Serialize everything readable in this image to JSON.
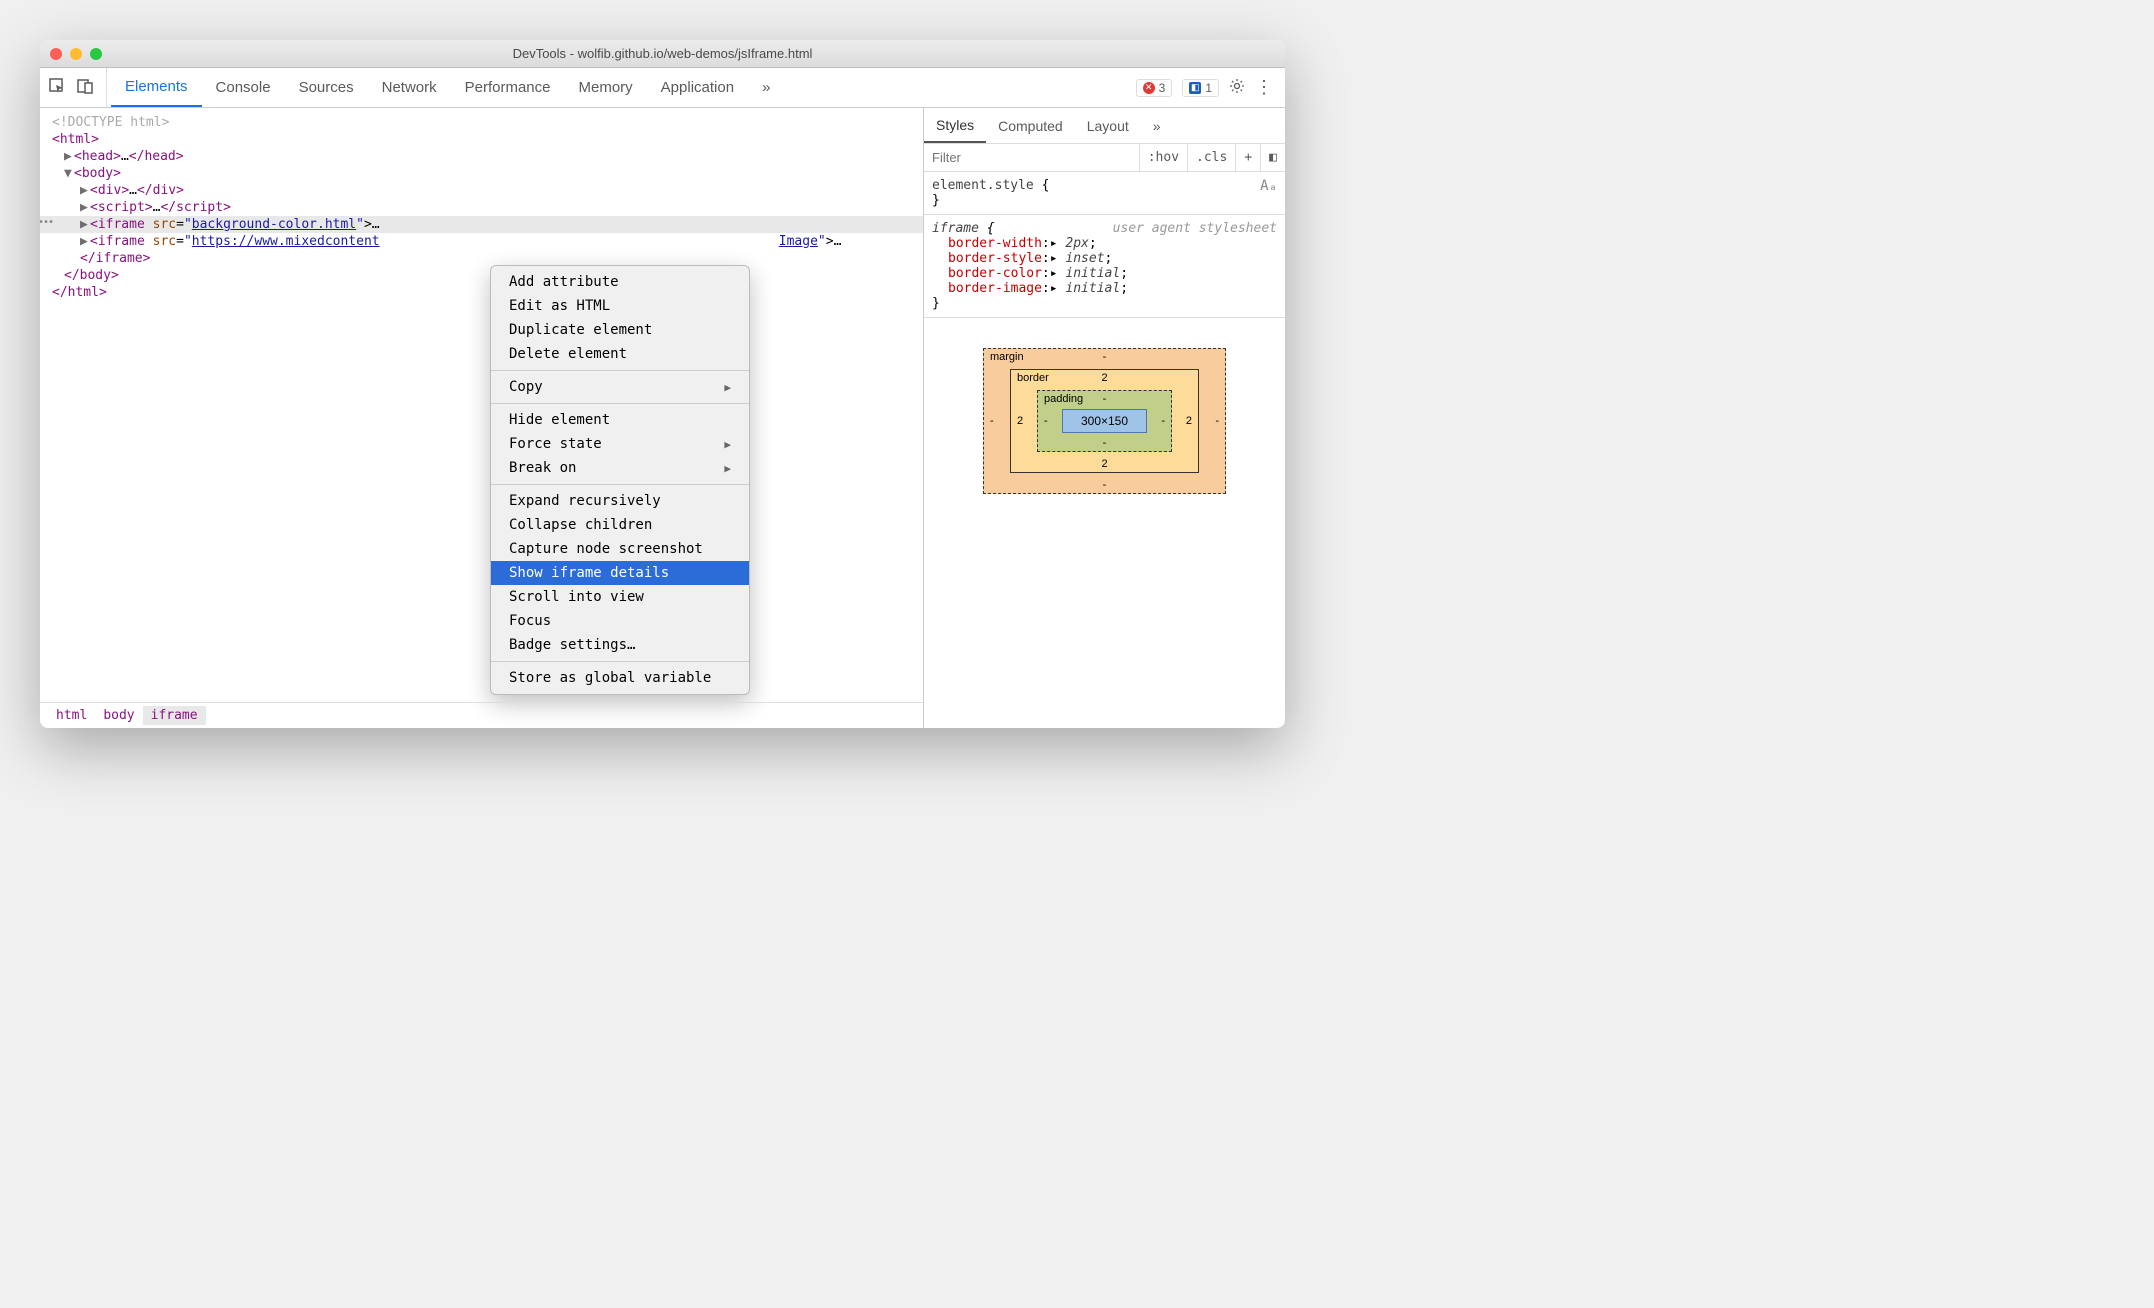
{
  "window": {
    "title": "DevTools - wolfib.github.io/web-demos/jsIframe.html"
  },
  "tabs": [
    "Elements",
    "Console",
    "Sources",
    "Network",
    "Performance",
    "Memory",
    "Application"
  ],
  "active_tab": "Elements",
  "more_tabs_glyph": "»",
  "errors": {
    "error_count": "3",
    "issue_count": "1"
  },
  "dom": {
    "doctype": "<!DOCTYPE html>",
    "html_open": "html",
    "head": {
      "open": "head",
      "ell": "…",
      "close": "head"
    },
    "body_open": "body",
    "div": {
      "open": "div",
      "ell": "…",
      "close": "div"
    },
    "script": {
      "open": "script",
      "ell": "…",
      "close": "script"
    },
    "iframe1": {
      "tag": "iframe",
      "attr": "src",
      "val": "background-color.html",
      "ell": ">…"
    },
    "iframe2": {
      "tag": "iframe",
      "attr": "src",
      "val": "https://www.mixedcontent",
      "title_attr": "Image",
      "ell": ">…"
    },
    "iframe_close": "iframe",
    "body_close": "body",
    "html_close": "html"
  },
  "breadcrumb": [
    "html",
    "body",
    "iframe"
  ],
  "context_menu": {
    "group1": [
      "Add attribute",
      "Edit as HTML",
      "Duplicate element",
      "Delete element"
    ],
    "copy": "Copy",
    "group2": [
      "Hide element"
    ],
    "force_state": "Force state",
    "break_on": "Break on",
    "group3": [
      "Expand recursively",
      "Collapse children",
      "Capture node screenshot"
    ],
    "highlighted": "Show iframe details",
    "group4": [
      "Scroll into view",
      "Focus",
      "Badge settings…"
    ],
    "group5": [
      "Store as global variable"
    ]
  },
  "styles_panel": {
    "subtabs": [
      "Styles",
      "Computed",
      "Layout"
    ],
    "active_subtab": "Styles",
    "filter_placeholder": "Filter",
    "hov": ":hov",
    "cls": ".cls",
    "element_style": {
      "selector": "element.style",
      "open": " {",
      "close": "}"
    },
    "iframe_rule": {
      "selector": "iframe",
      "open": " {",
      "source": "user agent stylesheet",
      "props": [
        {
          "name": "border-width",
          "value": "2px",
          "arrow": "▸"
        },
        {
          "name": "border-style",
          "value": "inset",
          "arrow": "▸"
        },
        {
          "name": "border-color",
          "value": "initial",
          "arrow": "▸"
        },
        {
          "name": "border-image",
          "value": "initial",
          "arrow": "▸"
        }
      ],
      "close": "}"
    }
  },
  "box_model": {
    "margin_label": "margin",
    "margin": "-",
    "border_label": "border",
    "border": "2",
    "padding_label": "padding",
    "padding": "-",
    "content": "300×150"
  }
}
